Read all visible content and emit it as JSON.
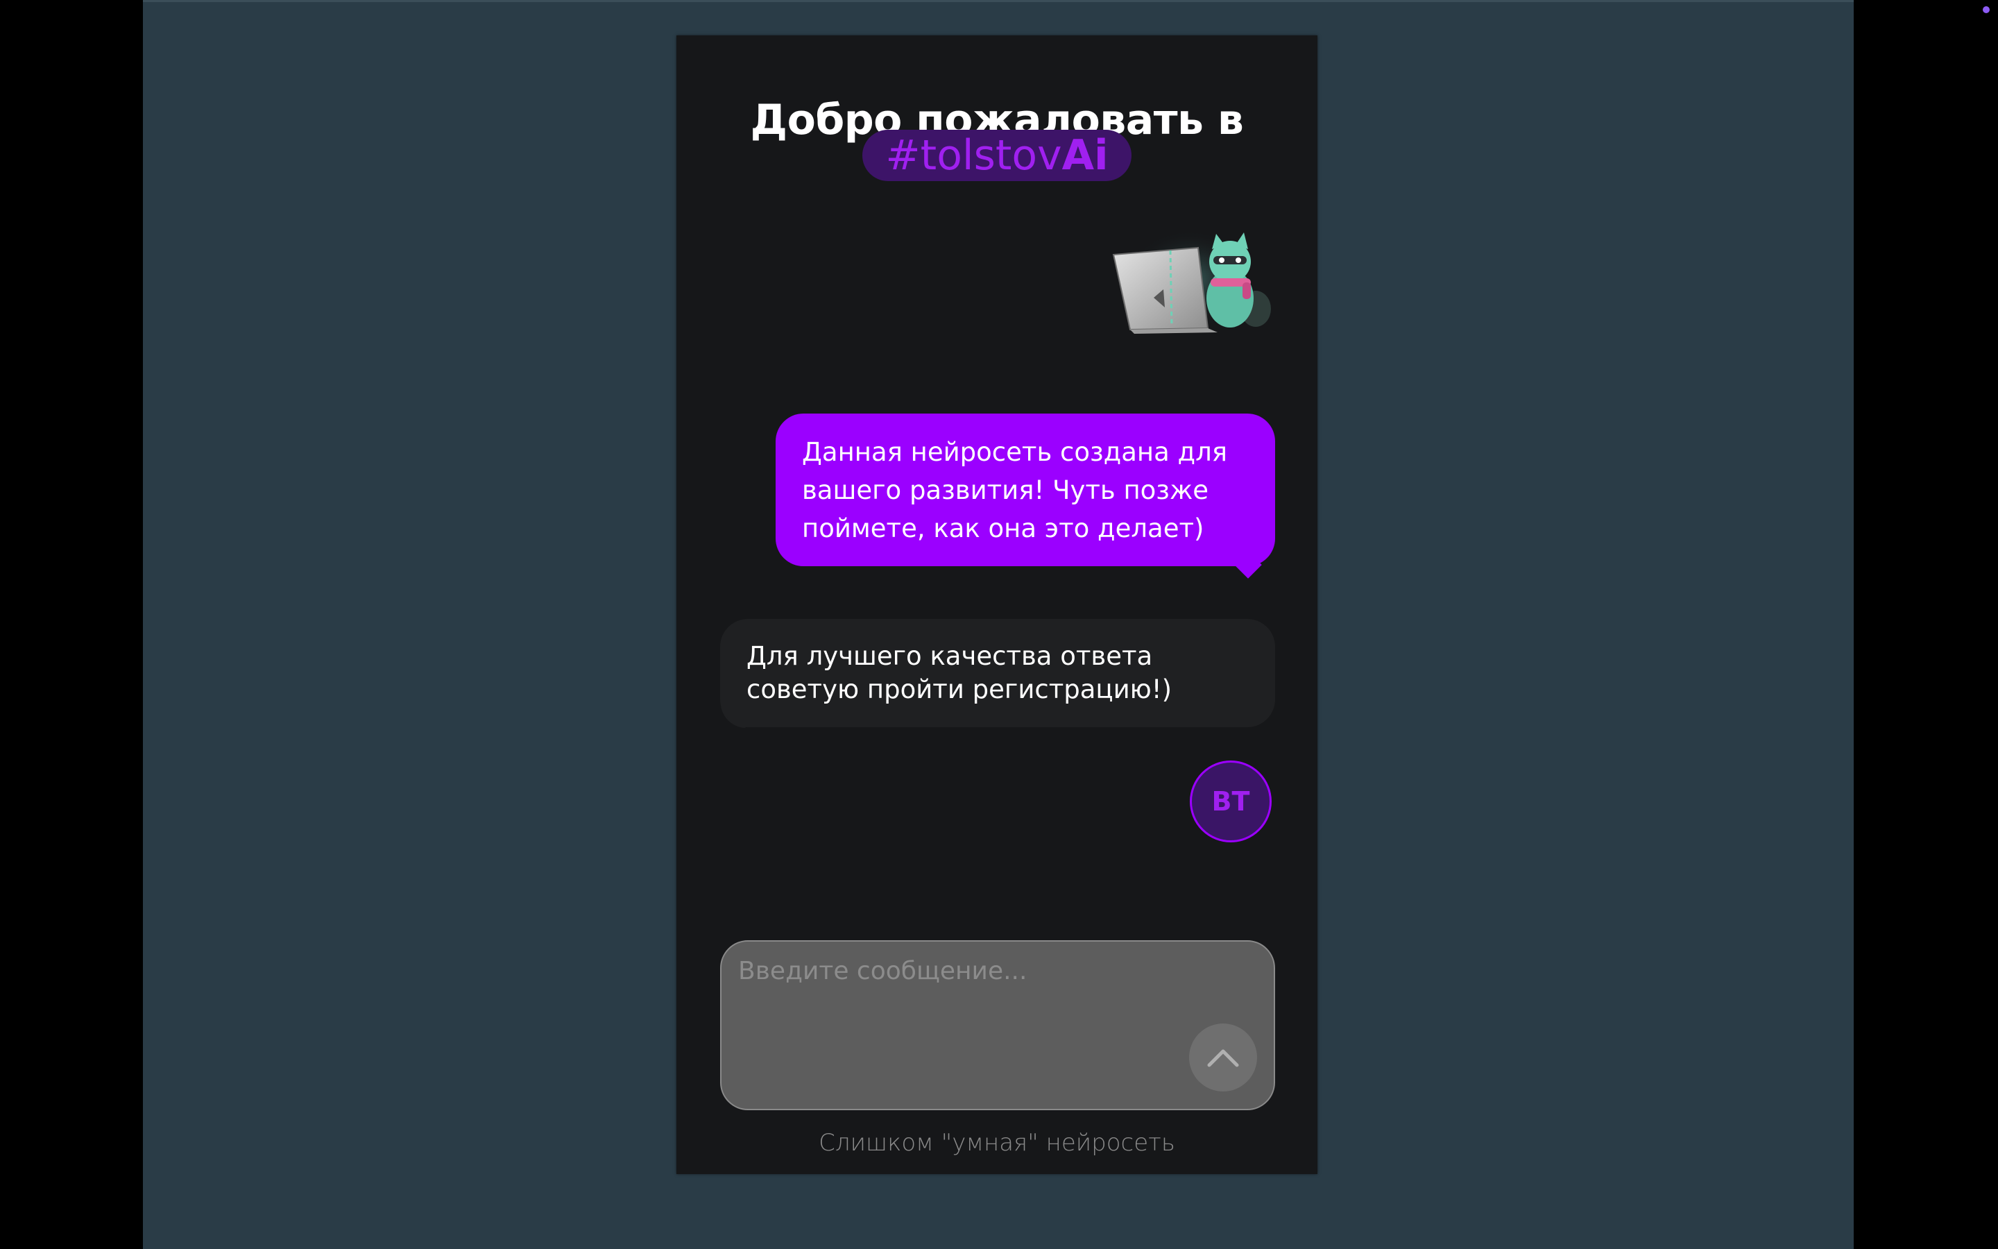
{
  "chat": {
    "welcome_title": "Добро пожаловать в",
    "brand_prefix": "#tolstov",
    "brand_suffix": "Ai",
    "messages": [
      {
        "role": "bot",
        "text": "Данная нейросеть создана для вашего развития! Чуть позже поймете, как она это делает)"
      },
      {
        "role": "bot",
        "text": "Для лучшего качества ответа советую пройти регистрацию!)"
      }
    ],
    "user_initials": "BT",
    "input_placeholder": "Введите сообщение...",
    "footer_note": "Слишком \"умная\" нейросеть"
  },
  "colors": {
    "desktop_bg": "#2a3c47",
    "panel_bg": "#161719",
    "accent": "#9b00ff",
    "brand_pill_bg": "#3d1468",
    "bot_bubble_secondary": "#1f2022",
    "input_bg": "#5d5d5d"
  },
  "icons": {
    "mascot": "raccoon-laptop-mascot",
    "send": "chevron-up-icon"
  }
}
